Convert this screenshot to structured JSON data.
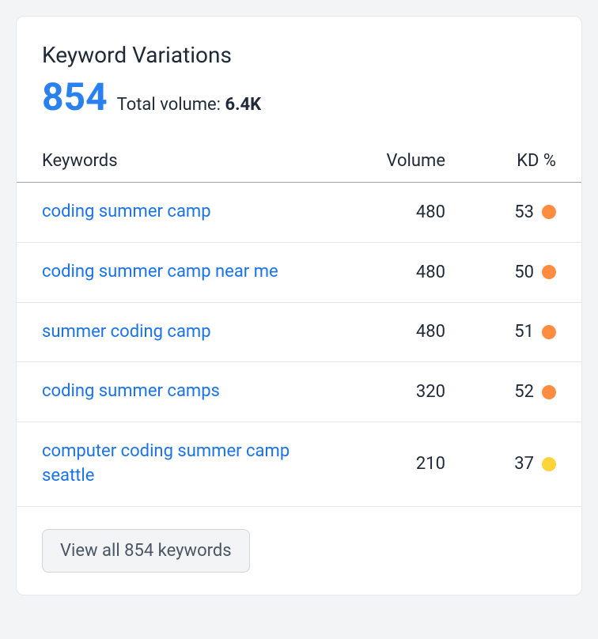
{
  "card": {
    "title": "Keyword Variations",
    "count": "854",
    "volume_label": "Total volume: ",
    "volume_value": "6.4K"
  },
  "columns": {
    "keywords": "Keywords",
    "volume": "Volume",
    "kd": "KD %"
  },
  "rows": [
    {
      "keyword": "coding summer camp",
      "volume": "480",
      "kd": "53",
      "color": "#ff8c3f"
    },
    {
      "keyword": "coding summer camp near me",
      "volume": "480",
      "kd": "50",
      "color": "#ff8c3f"
    },
    {
      "keyword": "summer coding camp",
      "volume": "480",
      "kd": "51",
      "color": "#ff8c3f"
    },
    {
      "keyword": "coding summer camps",
      "volume": "320",
      "kd": "52",
      "color": "#ff8c3f"
    },
    {
      "keyword": "computer coding summer camp seattle",
      "volume": "210",
      "kd": "37",
      "color": "#ffd43b"
    }
  ],
  "footer": {
    "button_label": "View all 854 keywords"
  }
}
